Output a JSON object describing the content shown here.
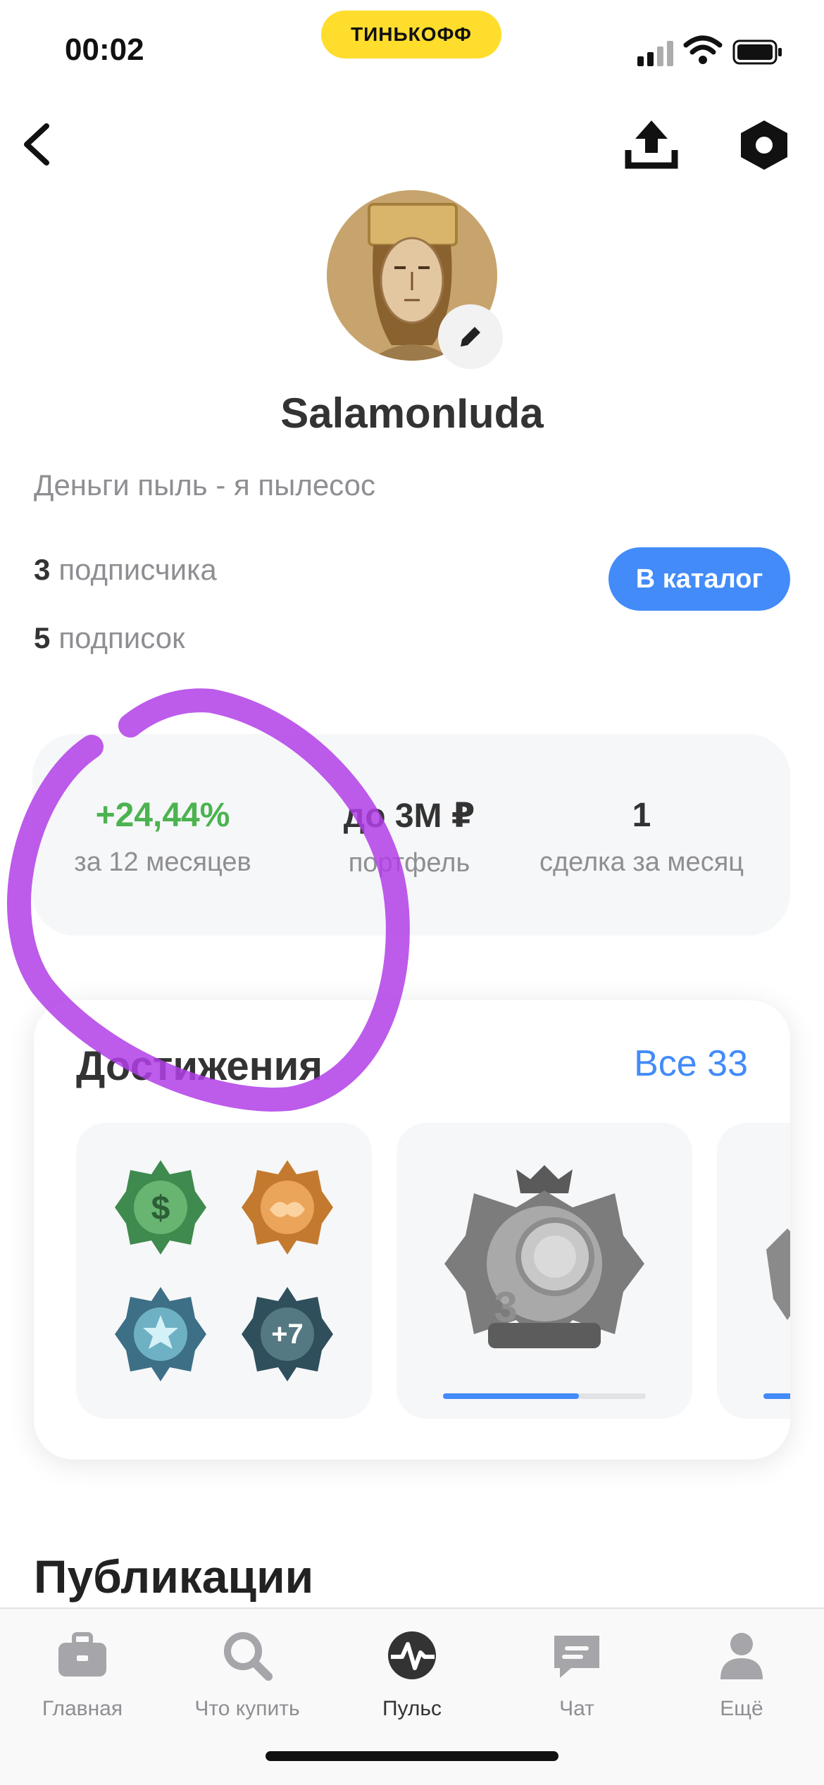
{
  "status_bar": {
    "time": "00:02",
    "brand": "ТИНЬКОФФ"
  },
  "profile": {
    "username": "SalamonIuda",
    "bio": "Деньги пыль - я пылесос",
    "followers": {
      "count": "3",
      "label": "подписчика"
    },
    "subscriptions": {
      "count": "5",
      "label": "подписок"
    },
    "catalog_button": "В каталог"
  },
  "metrics": [
    {
      "value": "+24,44%",
      "label": "за 12 месяцев",
      "color": "#4cb350"
    },
    {
      "value": "до 3М ₽",
      "label": "портфель",
      "color": "#333333"
    },
    {
      "value": "1",
      "label": "сделка за месяц",
      "color": "#333333"
    }
  ],
  "achievements": {
    "title": "Достижения",
    "all_link": "Все 33",
    "badges": [
      "money-badge-icon",
      "handshake-badge-icon",
      "stars-badge-icon"
    ],
    "more_count": "+7",
    "coin_level": "3",
    "coin_progress": 0.67,
    "third_progress": 0.3
  },
  "publications_title": "Публикации",
  "tabbar": [
    {
      "label": "Главная",
      "icon": "briefcase-icon",
      "active": false
    },
    {
      "label": "Что купить",
      "icon": "search-icon",
      "active": false
    },
    {
      "label": "Пульс",
      "icon": "pulse-icon",
      "active": true
    },
    {
      "label": "Чат",
      "icon": "chat-icon",
      "active": false
    },
    {
      "label": "Ещё",
      "icon": "profile-icon",
      "active": false
    }
  ],
  "colors": {
    "accent": "#428bf9",
    "brand_yellow": "#ffdd2d",
    "positive": "#4cb350",
    "annotation": "#b23ee8"
  }
}
